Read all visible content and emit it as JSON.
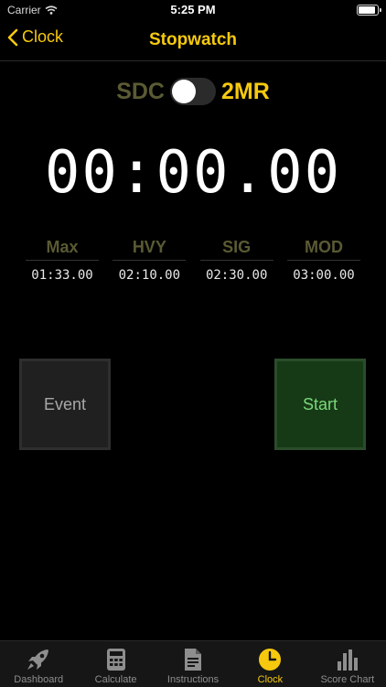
{
  "status_bar": {
    "carrier": "Carrier",
    "time": "5:25 PM"
  },
  "nav": {
    "back_label": "Clock",
    "title": "Stopwatch"
  },
  "mode": {
    "left_label": "SDC",
    "right_label": "2MR"
  },
  "timer": {
    "display": "00:00.00"
  },
  "categories": [
    {
      "name": "Max",
      "time": "01:33.00"
    },
    {
      "name": "HVY",
      "time": "02:10.00"
    },
    {
      "name": "SIG",
      "time": "02:30.00"
    },
    {
      "name": "MOD",
      "time": "03:00.00"
    }
  ],
  "buttons": {
    "event_label": "Event",
    "start_label": "Start"
  },
  "tabs": [
    {
      "label": "Dashboard",
      "icon": "rocket-icon"
    },
    {
      "label": "Calculate",
      "icon": "calculator-icon"
    },
    {
      "label": "Instructions",
      "icon": "document-icon"
    },
    {
      "label": "Clock",
      "icon": "clock-icon",
      "active": true
    },
    {
      "label": "Score Chart",
      "icon": "bar-chart-icon"
    }
  ],
  "colors": {
    "accent": "#f6c90e",
    "inactive_olive": "#5a5a34",
    "start_green": "#7bd87b",
    "tab_gray": "#8e8e8e"
  }
}
